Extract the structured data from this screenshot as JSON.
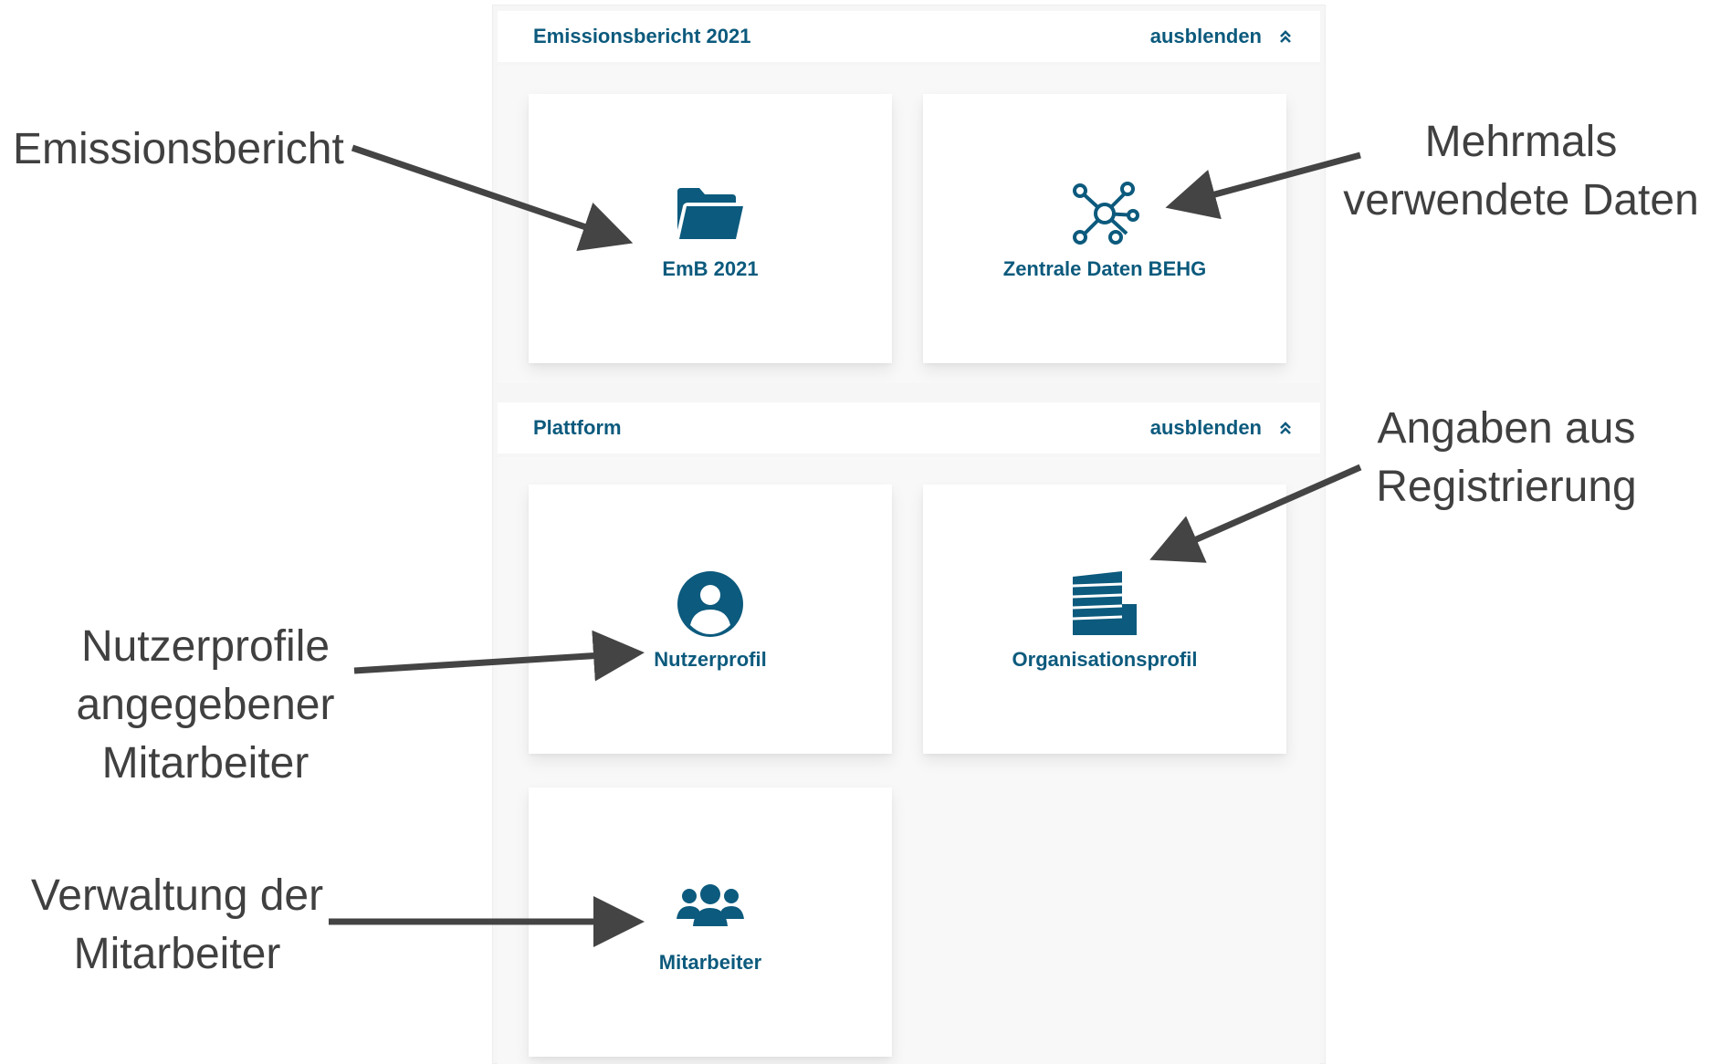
{
  "sections": [
    {
      "title": "Emissionsbericht 2021",
      "toggle_label": "ausblenden",
      "tiles": [
        {
          "label": "EmB 2021",
          "icon": "folder-icon"
        },
        {
          "label": "Zentrale Daten BEHG",
          "icon": "network-nodes-icon"
        }
      ]
    },
    {
      "title": "Plattform",
      "toggle_label": "ausblenden",
      "tiles": [
        {
          "label": "Nutzerprofil",
          "icon": "user-circle-icon"
        },
        {
          "label": "Organisationsprofil",
          "icon": "building-icon"
        },
        {
          "label": "Mitarbeiter",
          "icon": "users-group-icon"
        }
      ]
    }
  ],
  "annotations": {
    "emissionsbericht": "Emissionsbericht",
    "mehrmals_line1": "Mehrmals",
    "mehrmals_line2": "verwendete Daten",
    "angaben_line1": "Angaben aus",
    "angaben_line2": "Registrierung",
    "nutzerprofile_line1": "Nutzerprofile",
    "nutzerprofile_line2": "angegebener",
    "nutzerprofile_line3": "Mitarbeiter",
    "verwaltung_line1": "Verwaltung der",
    "verwaltung_line2": "Mitarbeiter"
  },
  "colors": {
    "accent": "#0c5a7d",
    "annotation_text": "#404040",
    "arrow": "#444444",
    "panel_bg": "#f6f6f6"
  }
}
